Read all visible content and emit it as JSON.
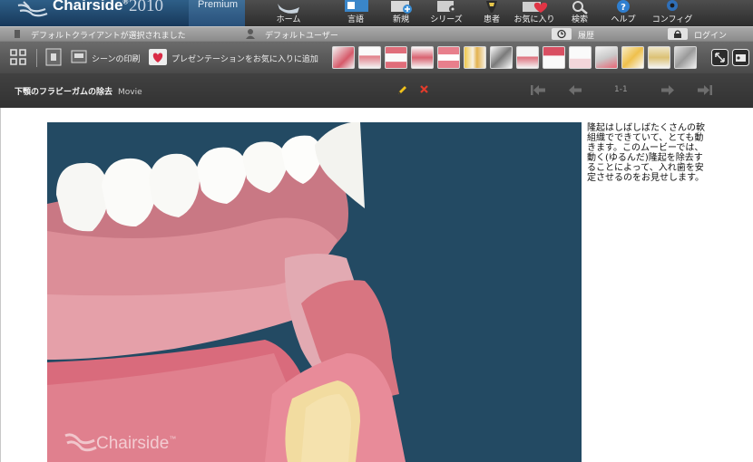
{
  "app": {
    "brand": "Chairside",
    "brand_mark": "®",
    "year": "2010",
    "edition": "Premium"
  },
  "nav": [
    {
      "label": "ホーム",
      "icon": "home-icon"
    },
    {
      "label": "言語",
      "icon": "language-icon"
    },
    {
      "label": "新規",
      "icon": "new-icon"
    },
    {
      "label": "シリーズ",
      "icon": "series-icon"
    },
    {
      "label": "患者",
      "icon": "patient-icon"
    },
    {
      "label": "お気に入り",
      "icon": "favorites-icon"
    },
    {
      "label": "検索",
      "icon": "search-icon"
    },
    {
      "label": "ヘルプ",
      "icon": "help-icon"
    },
    {
      "label": "コンフィグ",
      "icon": "config-icon"
    }
  ],
  "status": {
    "client": "デフォルトクライアントが選択されました",
    "user": "デフォルトユーザー",
    "history": "履歴",
    "login": "ログイン"
  },
  "toolbar": {
    "print_scene": "シーンの印刷",
    "add_favorite": "プレゼンテーションをお気に入りに追加"
  },
  "player": {
    "title": "下顎のフラビーガムの除去",
    "media_type": "Movie",
    "counter": "1-1"
  },
  "description": "隆起はしばしばたくさんの軟組織でできていて、とても動きます。このムービーでは、動く(ゆるんだ)隆起を除去することによって、入れ歯を安定させるのをお見せします。",
  "watermark": "Chairside",
  "watermark_mark": "™",
  "colors": {
    "brand_blue": "#1f4a72",
    "video_bg": "#234a63",
    "gum_pink": "#d9868f",
    "bone": "#f2dca0"
  }
}
